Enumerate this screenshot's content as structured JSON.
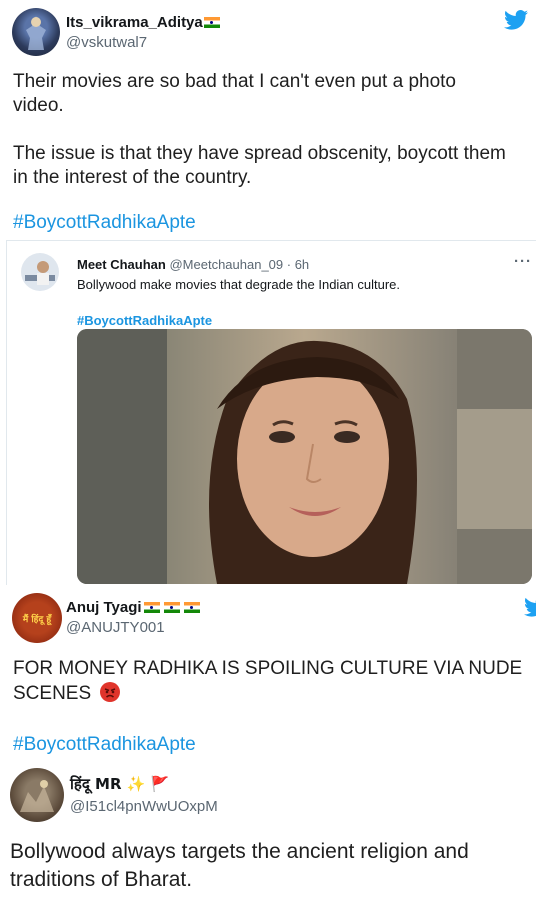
{
  "tweet1": {
    "name": "Its_vikrama_Aditya",
    "handle": "@vskutwal7",
    "text_line1": "Their movies are so bad that I can't even put a photo",
    "text_line2": "video.",
    "text_line3": "The issue is that they have spread obscenity, boycott them",
    "text_line4": "in the interest of the country.",
    "hashtag": "#BoycottRadhikaApte"
  },
  "quoted": {
    "name": "Meet Chauhan",
    "handle": "@Meetchauhan_09",
    "time": "· 6h",
    "text": "Bollywood make movies that degrade the Indian culture.",
    "hashtag": "#BoycottRadhikaApte",
    "more": "···"
  },
  "tweet2": {
    "name": "Anuj Tyagi",
    "handle": "@ANUJTY001",
    "text_line1": "FOR MONEY RADHIKA IS SPOILING CULTURE VIA NUDE",
    "text_line2": "SCENES",
    "hashtag": "#BoycottRadhikaApte",
    "avatar_text": "मैं हिंदू हूँ"
  },
  "tweet3": {
    "name": "हिंदू MR",
    "handle": "@I51cl4pnWwUOxpM",
    "text_line1": "Bollywood always targets the ancient religion and",
    "text_line2": "traditions of Bharat."
  },
  "colors": {
    "link": "#1b95e0",
    "twitter_blue": "#1da1f2",
    "muted": "#5b6772"
  },
  "icons": [
    "twitter-bird-icon",
    "india-flag-icon",
    "angry-face-icon",
    "sparkles-icon",
    "red-flag-icon",
    "more-icon"
  ]
}
